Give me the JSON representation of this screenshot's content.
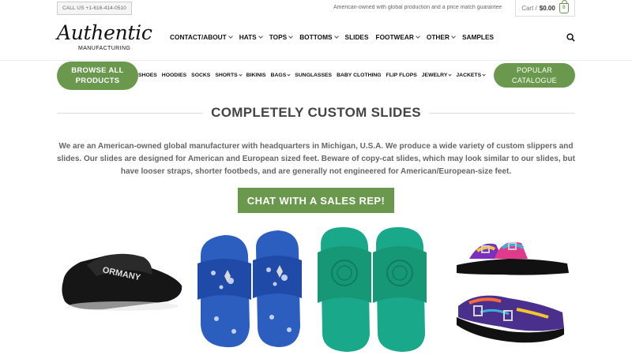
{
  "topbar": {
    "call": "CALL US +1-616-414-0510",
    "tagline": "American-owned with global production and a price match guarantee",
    "cart_label": "Cart /",
    "cart_total": "$0.00",
    "cart_count": "0"
  },
  "logo": {
    "script": "Authentic",
    "sub": "MANUFACTURING"
  },
  "mainnav": [
    {
      "label": "CONTACT/ABOUT",
      "dropdown": true
    },
    {
      "label": "HATS",
      "dropdown": true
    },
    {
      "label": "TOPS",
      "dropdown": true
    },
    {
      "label": "BOTTOMS",
      "dropdown": true
    },
    {
      "label": "SLIDES",
      "dropdown": false
    },
    {
      "label": "FOOTWEAR",
      "dropdown": true
    },
    {
      "label": "OTHER",
      "dropdown": true
    },
    {
      "label": "SAMPLES",
      "dropdown": false
    }
  ],
  "browse": "BROWSE ALL PRODUCTS",
  "popular": "POPULAR CATALOGUE",
  "subnav": [
    {
      "label": "SHOES",
      "dropdown": false
    },
    {
      "label": "HOODIES",
      "dropdown": false
    },
    {
      "label": "SOCKS",
      "dropdown": false
    },
    {
      "label": "SHORTS",
      "dropdown": true
    },
    {
      "label": "BIKINIS",
      "dropdown": false
    },
    {
      "label": "BAGS",
      "dropdown": true
    },
    {
      "label": "SUNGLASSES",
      "dropdown": false
    },
    {
      "label": "BABY CLOTHING",
      "dropdown": false
    },
    {
      "label": "FLIP FLOPS",
      "dropdown": false
    },
    {
      "label": "JEWELRY",
      "dropdown": true
    },
    {
      "label": "JACKETS",
      "dropdown": true
    }
  ],
  "section_title": "COMPLETELY CUSTOM SLIDES",
  "description": "We are an American-owned global manufacturer with headquarters in Michigan, U.S.A. We produce a wide variety of custom slippers and slides. Our slides are designed for American and European sized feet. Beware of copy-cat slides, which may look similar to our slides, but have looser straps, shorter footbeds, and are generally not engineered for American/European-size feet.",
  "cta": "CHAT WITH A SALES REP!",
  "products": [
    {
      "name": "black-slide",
      "strap_text": "ORMANY"
    },
    {
      "name": "blue-bandana-slides"
    },
    {
      "name": "teal-embossed-slides"
    },
    {
      "name": "patterned-buckle-sandals"
    }
  ],
  "colors": {
    "accent": "#6a994e",
    "text": "#333333"
  }
}
